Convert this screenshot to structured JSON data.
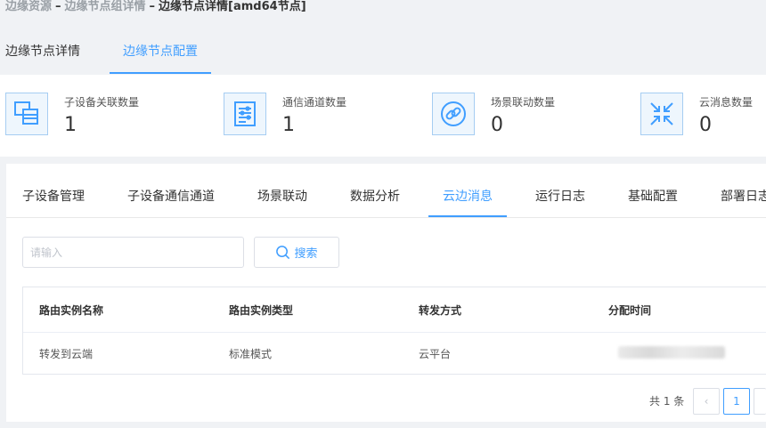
{
  "breadcrumb": {
    "items": [
      "边缘资源",
      "边缘节点组详情",
      "边缘节点详情[amd64节点]"
    ],
    "separator": "–"
  },
  "top_tabs": [
    {
      "label": "边缘节点详情",
      "active": false
    },
    {
      "label": "边缘节点配置",
      "active": true
    }
  ],
  "stats": [
    {
      "label": "子设备关联数量",
      "value": "1",
      "icon": "device-link-icon"
    },
    {
      "label": "通信通道数量",
      "value": "1",
      "icon": "channel-list-icon"
    },
    {
      "label": "场景联动数量",
      "value": "0",
      "icon": "link-chain-icon"
    },
    {
      "label": "云消息数量",
      "value": "0",
      "icon": "arrows-converge-icon"
    }
  ],
  "sub_tabs": [
    {
      "label": "子设备管理",
      "active": false
    },
    {
      "label": "子设备通信通道",
      "active": false
    },
    {
      "label": "场景联动",
      "active": false
    },
    {
      "label": "数据分析",
      "active": false
    },
    {
      "label": "云边消息",
      "active": true
    },
    {
      "label": "运行日志",
      "active": false
    },
    {
      "label": "基础配置",
      "active": false
    },
    {
      "label": "部署日志",
      "active": false
    }
  ],
  "search": {
    "placeholder": "请输入",
    "value": "",
    "button_label": "搜索"
  },
  "table": {
    "columns": [
      "路由实例名称",
      "路由实例类型",
      "转发方式",
      "分配时间"
    ],
    "rows": [
      {
        "name": "转发到云端",
        "type": "标准模式",
        "mode": "云平台",
        "time": ""
      }
    ]
  },
  "pagination": {
    "total_label": "共 1 条",
    "current_page": "1",
    "prev_symbol": "‹"
  },
  "colors": {
    "accent": "#409eff",
    "icon_bg": "#eef6fd",
    "icon_border": "#a6cdf2"
  }
}
